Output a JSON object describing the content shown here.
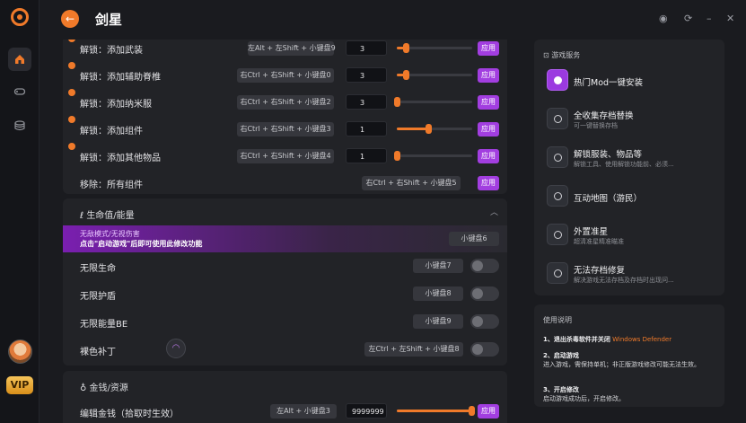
{
  "app": {
    "title": "剑星",
    "back_glyph": "←",
    "window_controls": [
      "◉",
      "⟳",
      "–",
      "✕"
    ]
  },
  "rail": {
    "icons": [
      "home-icon",
      "gamepad-icon",
      "database-icon"
    ],
    "vip_label": "VIP"
  },
  "section1": {
    "rows": [
      {
        "label": "解锁：添加武装",
        "key": "左Alt + 左Shift + 小键盘9",
        "value": "3",
        "fill": 0.12,
        "apply": "应用",
        "info": true
      },
      {
        "label": "解锁：添加辅助脊椎",
        "key": "右Ctrl + 右Shift + 小键盘0",
        "value": "3",
        "fill": 0.12,
        "apply": "应用",
        "info": true
      },
      {
        "label": "解锁：添加纳米服",
        "key": "右Ctrl + 右Shift + 小键盘2",
        "value": "3",
        "fill": 0.0,
        "apply": "应用",
        "info": true
      },
      {
        "label": "解锁：添加组件",
        "key": "右Ctrl + 右Shift + 小键盘3",
        "value": "1",
        "fill": 0.42,
        "apply": "应用",
        "info": true
      },
      {
        "label": "解锁：添加其他物品",
        "key": "右Ctrl + 右Shift + 小键盘4",
        "value": "1",
        "fill": 0.0,
        "apply": "应用",
        "info": true
      }
    ],
    "remove_row": {
      "label": "移除：所有组件",
      "key": "右Ctrl + 右Shift + 小键盘5",
      "apply": "应用"
    }
  },
  "section2": {
    "title": "生命值/能量",
    "icon": "pin-icon",
    "chevron": "︿",
    "banner": {
      "line1": "无敌模式/无视伤害",
      "line2": "点击\"启动游戏\"后即可使用此修改功能",
      "key": "小键盘6"
    },
    "rows": [
      {
        "label": "无限生命",
        "key": "小键盘7"
      },
      {
        "label": "无限护盾",
        "key": "小键盘8"
      },
      {
        "label": "无限能量BE",
        "key": "小键盘9"
      },
      {
        "label": "裸色补丁",
        "key": "左Ctrl + 左Shift + 小键盘8"
      }
    ]
  },
  "section3": {
    "title": "金钱/资源",
    "icon": "money-bag-icon",
    "rows": [
      {
        "label": "编辑金钱（拾取时生效）",
        "key": "左Alt + 小键盘3",
        "value": "9999999",
        "fill": 1.0,
        "apply": "应用"
      }
    ]
  },
  "services": {
    "title": "游戏服务",
    "items": [
      {
        "name": "热门Mod一键安装",
        "desc": "",
        "icon": "mod-icon",
        "hot": true
      },
      {
        "name": "全收集存档替换",
        "desc": "可一键替换存档",
        "icon": "download-icon",
        "hot": false
      },
      {
        "name": "解锁服装、物品等",
        "desc": "解锁工具、使用解锁功能前、必须...",
        "icon": "unlock-icon",
        "hot": false
      },
      {
        "name": "互动地图（游民）",
        "desc": "",
        "icon": "map-icon",
        "hot": false
      },
      {
        "name": "外置准星",
        "desc": "超清准星精准瞄准",
        "icon": "crosshair-icon",
        "hot": false
      },
      {
        "name": "无法存档修复",
        "desc": "解决游戏无法存档及存档时出现问...",
        "icon": "repair-icon",
        "hot": false
      }
    ]
  },
  "usage": {
    "title": "使用说明",
    "steps": [
      {
        "head": "1、退出杀毒软件并关闭",
        "highlight": "Windows Defender",
        "body": ""
      },
      {
        "head": "2、启动游戏",
        "highlight": "",
        "body": "进入游戏，需保持单机；非正版游戏修改可能无法生效。"
      },
      {
        "head": "3、开启修改",
        "highlight": "",
        "body": "启动游戏成功后，开启修改。"
      }
    ]
  },
  "colors": {
    "accent": "#f07a2a",
    "apply": "#a23ee0",
    "banner": "#7a1fb0"
  }
}
